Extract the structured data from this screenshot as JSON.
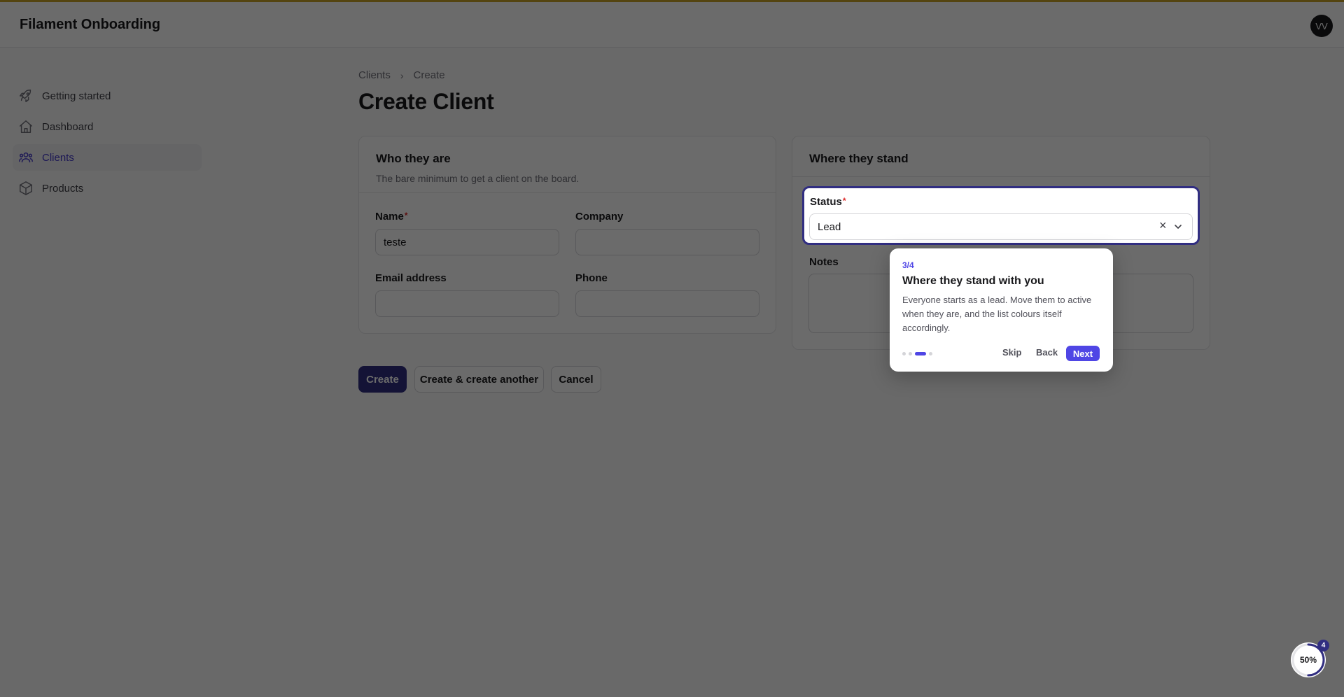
{
  "app": {
    "title": "Filament Onboarding",
    "user_initials": "VV"
  },
  "sidebar": {
    "items": [
      {
        "label": "Getting started",
        "icon": "rocket-icon",
        "active": false
      },
      {
        "label": "Dashboard",
        "icon": "home-icon",
        "active": false
      },
      {
        "label": "Clients",
        "icon": "users-icon",
        "active": true
      },
      {
        "label": "Products",
        "icon": "cube-icon",
        "active": false
      }
    ]
  },
  "breadcrumb": {
    "parent": "Clients",
    "separator": "›",
    "current": "Create"
  },
  "page": {
    "title": "Create Client"
  },
  "section_who": {
    "title": "Who they are",
    "description": "The bare minimum to get a client on the board.",
    "fields": {
      "name": {
        "label": "Name",
        "required_mark": "*",
        "value": "teste"
      },
      "company": {
        "label": "Company",
        "value": ""
      },
      "email": {
        "label": "Email address",
        "value": ""
      },
      "phone": {
        "label": "Phone",
        "value": ""
      }
    }
  },
  "section_where": {
    "title": "Where they stand",
    "status": {
      "label": "Status",
      "required_mark": "*",
      "value": "Lead",
      "clear_icon": "close-icon",
      "chevron_icon": "chevron-down-icon"
    },
    "notes": {
      "label": "Notes",
      "value": ""
    }
  },
  "actions": {
    "create": "Create",
    "create_another": "Create & create another",
    "cancel": "Cancel"
  },
  "tour": {
    "step": "3/4",
    "title": "Where they stand with you",
    "body": "Everyone starts as a lead. Move them to active when they are, and the list colours itself accordingly.",
    "current_step": 3,
    "total_steps": 4,
    "skip": "Skip",
    "back": "Back",
    "next": "Next"
  },
  "progress_widget": {
    "percent_label": "50%",
    "percent": 0.5,
    "badge": "4"
  },
  "colors": {
    "accent": "#4f46e5",
    "primary_button": "#312e81",
    "top_line": "#c9a227"
  }
}
